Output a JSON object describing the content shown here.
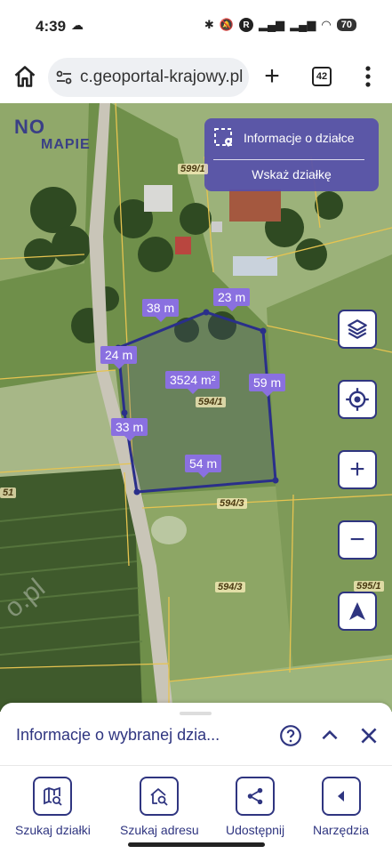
{
  "status_bar": {
    "time": "4:39",
    "battery": "70",
    "r_badge": "R"
  },
  "browser": {
    "url": "c.geoportal-krajowy.pl",
    "tab_count": "42"
  },
  "map": {
    "logo": {
      "part1": "NO",
      "part2": "MAPIE"
    },
    "info_panel": {
      "title": "Informacje o działce",
      "action": "Wskaż działkę"
    },
    "measurements": {
      "top_left": "38 m",
      "top_right": "23 m",
      "left_upper": "24 m",
      "right": "59 m",
      "left_lower": "33 m",
      "bottom": "54 m",
      "area": "3524 m²"
    },
    "parcels": {
      "p_599": "599/1",
      "p_594_1": "594/1",
      "p_594_3a": "594/3",
      "p_594_3b": "594/3",
      "p_595": "595/1",
      "p_51": "51"
    },
    "watermark": "o.pl",
    "controls": [
      "layers-icon",
      "locate-icon",
      "zoom-in-icon",
      "zoom-out-icon",
      "north-arrow-icon"
    ]
  },
  "sheet": {
    "title": "Informacje o wybranej dzia..."
  },
  "bottom_nav": {
    "items": [
      {
        "label": "Szukaj działki",
        "icon": "parcel-search-icon"
      },
      {
        "label": "Szukaj adresu",
        "icon": "address-search-icon"
      },
      {
        "label": "Udostępnij",
        "icon": "share-icon"
      },
      {
        "label": "Narzędzia",
        "icon": "tools-icon"
      }
    ]
  },
  "colors": {
    "accent": "#2f3580",
    "panel": "#5650aa",
    "measure": "#8a70e0"
  }
}
